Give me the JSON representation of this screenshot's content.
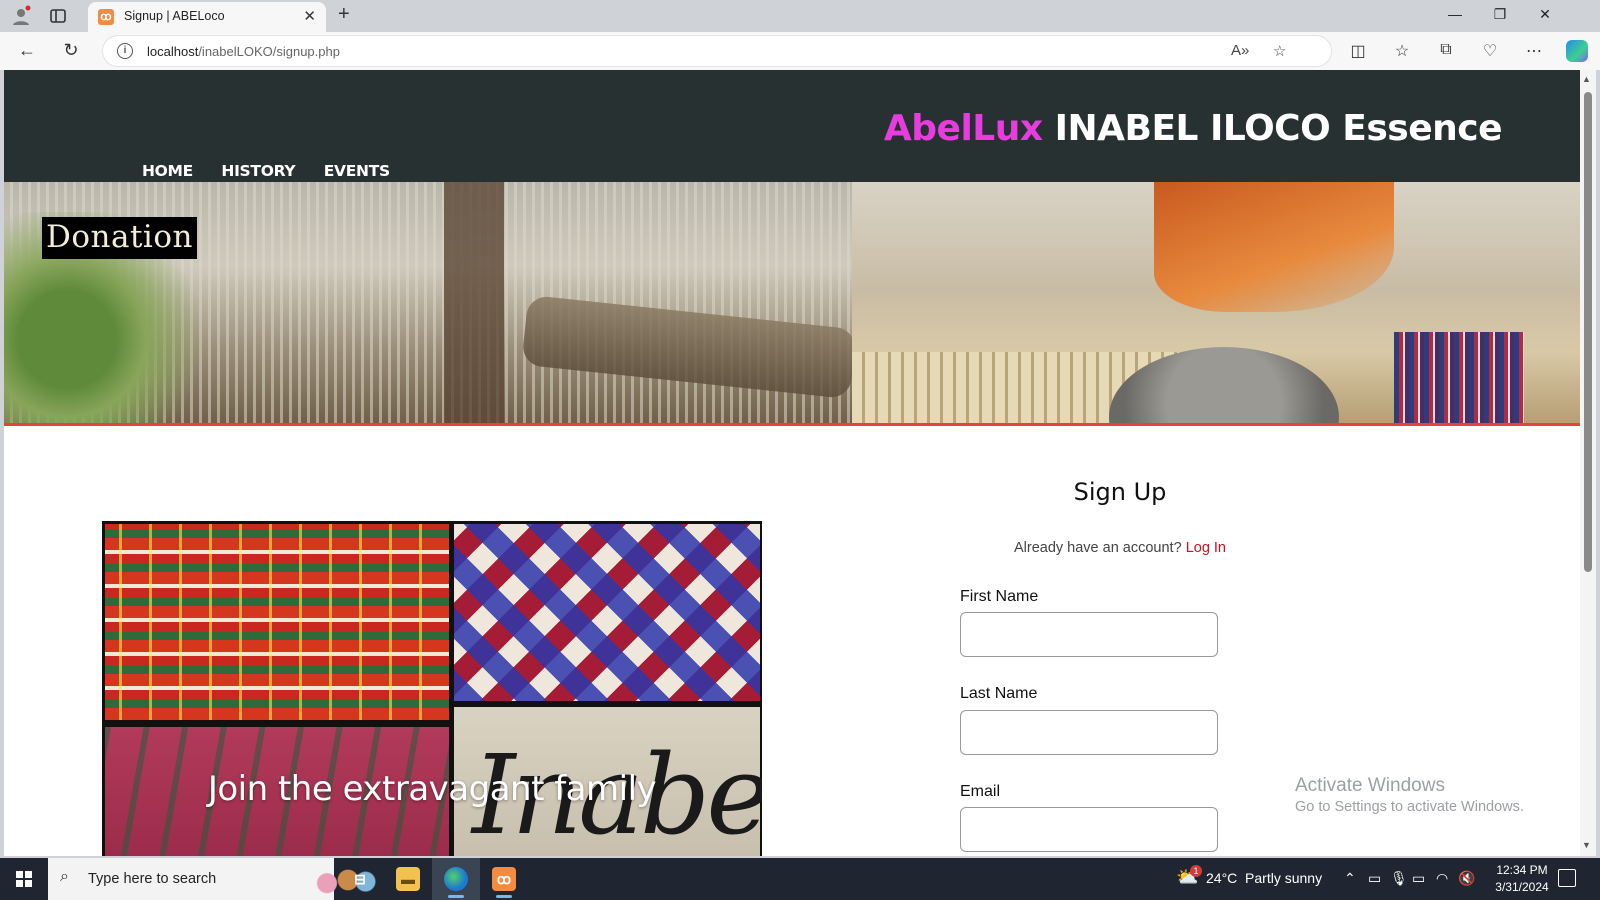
{
  "browser": {
    "tab_title": "Signup | ABELoco",
    "tab_close": "✕",
    "new_tab": "+",
    "url_host": "localhost",
    "url_path": "/inabelLOKO/signup.php",
    "win_minimize": "—",
    "win_restore": "❐",
    "win_close": "✕"
  },
  "header": {
    "brand_accent": "AbelLux",
    "brand_main": " INABEL ILOCO Essence",
    "accent_color": "#e83ce0",
    "nav": [
      "HOME",
      "HISTORY",
      "EVENTS"
    ]
  },
  "hero": {
    "badge": "Donation"
  },
  "collage": {
    "caption": "Join the extravagant family",
    "script_text": "Inabe"
  },
  "signup": {
    "title": "Sign Up",
    "already_text": "Already have an account?",
    "login_link": "Log In",
    "fields": [
      {
        "label": "First Name",
        "value": ""
      },
      {
        "label": "Last Name",
        "value": ""
      },
      {
        "label": "Email",
        "value": ""
      }
    ]
  },
  "watermark": {
    "line1": "Activate Windows",
    "line2": "Go to Settings to activate Windows."
  },
  "taskbar": {
    "search_placeholder": "Type here to search",
    "weather": "24°C  Partly sunny",
    "weather_badge": "1",
    "time": "12:34 PM",
    "date": "3/31/2024"
  }
}
